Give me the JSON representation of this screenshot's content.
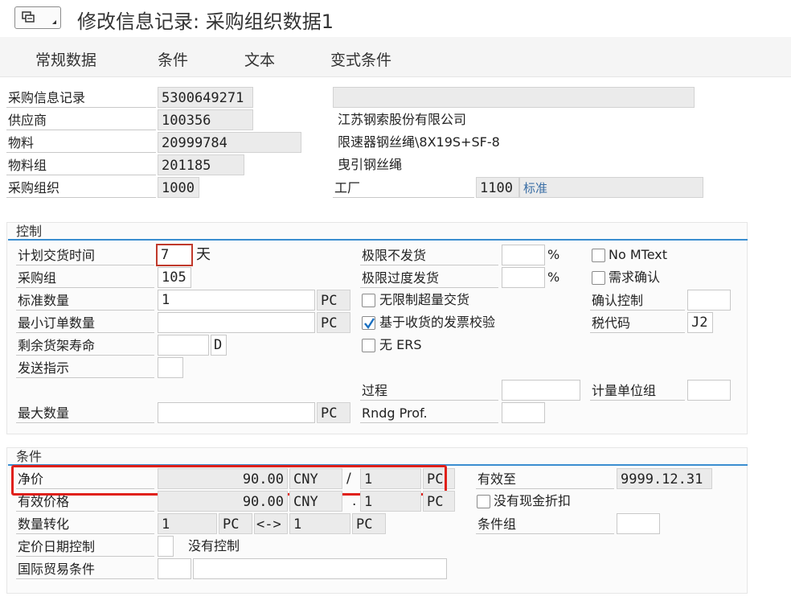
{
  "header": {
    "title": "修改信息记录: 采购组织数据1",
    "menu_icon": "menu-grid-icon"
  },
  "tabs": [
    "常规数据",
    "条件",
    "文本",
    "变式条件"
  ],
  "top": {
    "info_record_label": "采购信息记录",
    "info_record_value": "5300649271",
    "vendor_label": "供应商",
    "vendor_value": "100356",
    "vendor_name": "江苏钢索股份有限公司",
    "material_label": "物料",
    "material_value": "20999784",
    "material_desc": "限速器钢丝绳\\8X19S+SF-8",
    "material_group_label": "物料组",
    "material_group_value": "201185",
    "material_group_desc": "曳引钢丝绳",
    "purch_org_label": "采购组织",
    "purch_org_value": "1000",
    "plant_label": "工厂",
    "plant_value": "1100",
    "plant_desc": "标准"
  },
  "control": {
    "heading": "控制",
    "planned_delivery_label": "计划交货时间",
    "planned_delivery_value": "7",
    "days_unit": "天",
    "purch_group_label": "采购组",
    "purch_group_value": "105",
    "std_qty_label": "标准数量",
    "std_qty_value": "1",
    "std_qty_unit": "PC",
    "min_order_label": "最小订单数量",
    "min_order_unit": "PC",
    "shelf_life_label": "剩余货架寿命",
    "shelf_life_unit": "D",
    "shipping_instr_label": "发送指示",
    "max_qty_label": "最大数量",
    "max_qty_unit": "PC",
    "underdelivery_label": "极限不发货",
    "overdelivery_label": "极限过度发货",
    "percent": "%",
    "unlimited_over_label": "无限制超量交货",
    "unlimited_over_checked": false,
    "gr_based_iv_label": "基于收货的发票校验",
    "gr_based_iv_checked": true,
    "no_ers_label": "无 ERS",
    "no_ers_checked": false,
    "procedure_label": "过程",
    "rndg_label": "Rndg Prof.",
    "no_mtext_label": "No MText",
    "no_mtext_checked": false,
    "ack_reqd_label": "需求确认",
    "ack_reqd_checked": false,
    "conf_control_label": "确认控制",
    "tax_code_label": "税代码",
    "tax_code_value": "J2",
    "uom_group_label": "计量单位组"
  },
  "conditions": {
    "heading": "条件",
    "net_price_label": "净价",
    "net_price_value": "90.00",
    "net_price_currency": "CNY",
    "slash": "/",
    "net_price_per": "1",
    "net_price_unit": "PC",
    "valid_to_label": "有效至",
    "valid_to_value": "9999.12.31",
    "eff_price_label": "有效价格",
    "eff_price_value": "90.00",
    "eff_price_currency": "CNY",
    "dot": ".",
    "eff_price_per": "1",
    "eff_price_unit": "PC",
    "no_cash_disc_label": "没有现金折扣",
    "no_cash_disc_checked": false,
    "qty_conv_label": "数量转化",
    "qty_conv_left": "1",
    "qty_conv_left_unit": "PC",
    "qty_conv_arrow": "<->",
    "qty_conv_right": "1",
    "qty_conv_right_unit": "PC",
    "cond_group_label": "条件组",
    "pricing_date_label": "定价日期控制",
    "pricing_date_desc": "没有控制",
    "incoterms_label": "国际贸易条件"
  },
  "colors": {
    "accent": "#3a8ed0",
    "highlight_frame": "#e0201a",
    "cursor_frame": "#c0392b",
    "plant_desc_text": "#3a6ea5"
  }
}
